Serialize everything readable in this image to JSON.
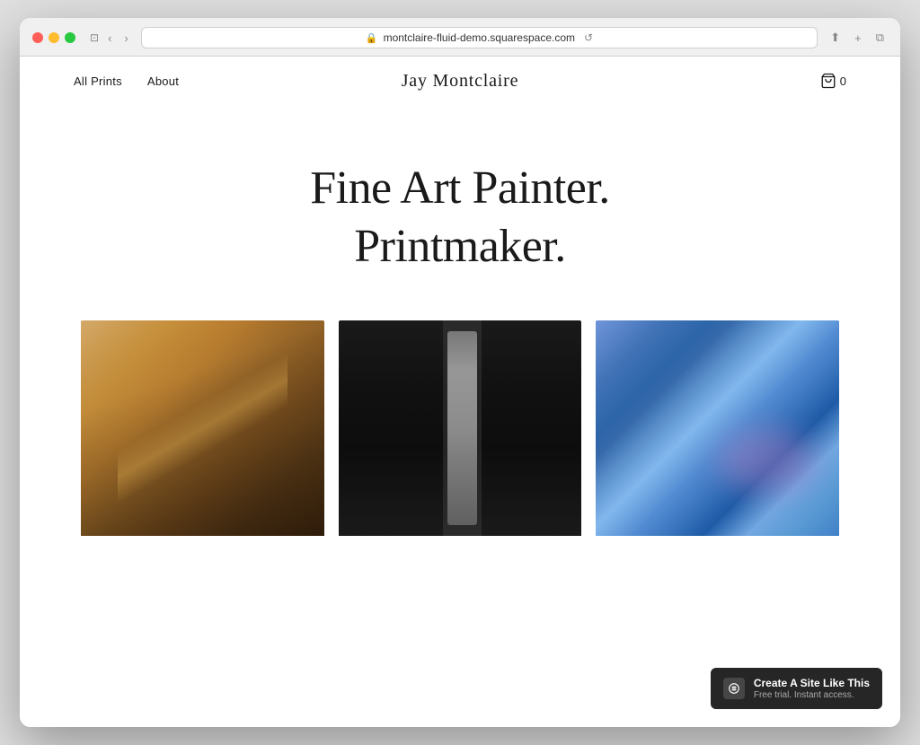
{
  "browser": {
    "url": "montclaire-fluid-demo.squarespace.com",
    "tab_icon": "🔒",
    "back_btn": "‹",
    "forward_btn": "›",
    "refresh_btn": "↺",
    "share_btn": "⬆",
    "new_tab_btn": "+",
    "duplicate_btn": "⧉",
    "window_tile_btn": "⬜"
  },
  "site": {
    "nav": {
      "all_prints_label": "All Prints",
      "about_label": "About",
      "cart_count": "0"
    },
    "title": "Jay Montclaire",
    "hero": {
      "line1": "Fine Art Painter.",
      "line2": "Printmaker."
    },
    "badge": {
      "title": "Create A Site Like This",
      "subtitle": "Free trial. Instant access."
    }
  }
}
